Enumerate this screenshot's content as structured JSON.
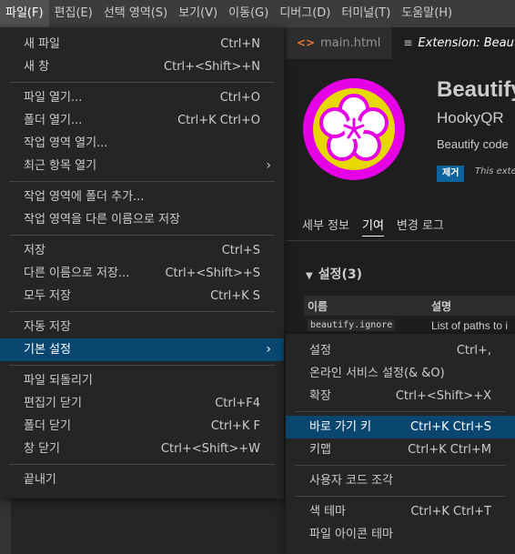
{
  "menubar": {
    "items": [
      "파일(F)",
      "편집(E)",
      "선택 영역(S)",
      "보기(V)",
      "이동(G)",
      "디버그(D)",
      "터미널(T)",
      "도움말(H)"
    ]
  },
  "tabs": {
    "main_html": "main.html",
    "extension": "Extension: Beautify"
  },
  "extension": {
    "name": "Beautify",
    "publisher": "HookyQR",
    "description": "Beautify code",
    "remove_label": "제거",
    "note": "This extension",
    "nav": [
      "세부 정보",
      "기여",
      "변경 로그"
    ],
    "settings_header": "설정(3)",
    "table_headers": [
      "이름",
      "설명"
    ],
    "row_key": "beautify.ignore",
    "row_desc": "List of paths to i",
    "colors": {
      "logo_outer": "#e600e6",
      "logo_ring": "#e6d800",
      "logo_flower": "#ffffff",
      "remove_button": "#0e639c"
    }
  },
  "file_menu": {
    "groups": [
      [
        {
          "label": "새 파일",
          "shortcut": "Ctrl+N"
        },
        {
          "label": "새 창",
          "shortcut": "Ctrl+<Shift>+N"
        }
      ],
      [
        {
          "label": "파일 열기...",
          "shortcut": "Ctrl+O"
        },
        {
          "label": "폴더 열기...",
          "shortcut": "Ctrl+K Ctrl+O"
        },
        {
          "label": "작업 영역 열기...",
          "shortcut": ""
        },
        {
          "label": "최근 항목 열기",
          "shortcut": ""
        }
      ],
      [
        {
          "label": "작업 영역에 폴더 추가...",
          "shortcut": ""
        },
        {
          "label": "작업 영역을 다른 이름으로 저장",
          "shortcut": ""
        }
      ],
      [
        {
          "label": "저장",
          "shortcut": "Ctrl+S"
        },
        {
          "label": "다른 이름으로 저장...",
          "shortcut": "Ctrl+<Shift>+S"
        },
        {
          "label": "모두 저장",
          "shortcut": "Ctrl+K S"
        }
      ],
      [
        {
          "label": "자동 저장",
          "shortcut": ""
        },
        {
          "label": "기본 설정",
          "shortcut": ""
        }
      ],
      [
        {
          "label": "파일 되돌리기",
          "shortcut": ""
        },
        {
          "label": "편집기 닫기",
          "shortcut": "Ctrl+F4"
        },
        {
          "label": "폴더 닫기",
          "shortcut": "Ctrl+K F"
        },
        {
          "label": "창 닫기",
          "shortcut": "Ctrl+<Shift>+W"
        }
      ],
      [
        {
          "label": "끝내기",
          "shortcut": ""
        }
      ]
    ]
  },
  "preferences_menu": {
    "groups": [
      [
        {
          "label": "설정",
          "shortcut": "Ctrl+,"
        },
        {
          "label": "온라인 서비스 설정(& &O)",
          "shortcut": ""
        },
        {
          "label": "확장",
          "shortcut": "Ctrl+<Shift>+X"
        }
      ],
      [
        {
          "label": "바로 가기 키",
          "shortcut": "Ctrl+K Ctrl+S"
        },
        {
          "label": "키맵",
          "shortcut": "Ctrl+K Ctrl+M"
        }
      ],
      [
        {
          "label": "사용자 코드 조각",
          "shortcut": ""
        }
      ],
      [
        {
          "label": "색 테마",
          "shortcut": "Ctrl+K Ctrl+T"
        },
        {
          "label": "파일 아이콘 테마",
          "shortcut": ""
        }
      ]
    ]
  }
}
